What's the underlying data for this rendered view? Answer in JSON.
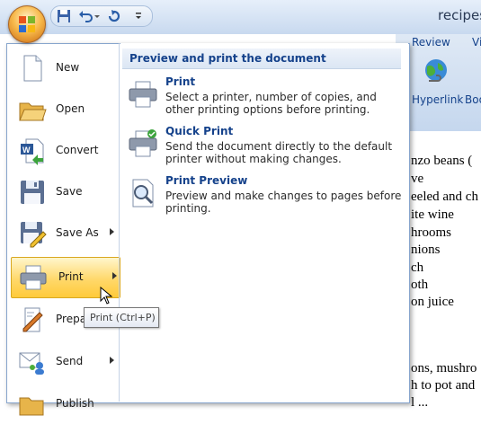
{
  "window": {
    "doc_title": "recipes"
  },
  "ribbon": {
    "tabs": [
      "Review",
      "Vi"
    ],
    "hyperlink_label": "Hyperlink",
    "book_label": "Boo"
  },
  "document": {
    "lines": [
      "nzo beans (",
      "ve",
      "eeled and ch",
      "ite wine",
      "hrooms",
      "nions",
      "ch",
      "oth",
      "on juice",
      "",
      "",
      "ons, mushro",
      "h to pot and",
      "l ... "
    ]
  },
  "office_menu": {
    "items": [
      {
        "label": "New",
        "icon": "new-document-icon",
        "has_submenu": false
      },
      {
        "label": "Open",
        "icon": "open-folder-icon",
        "has_submenu": false
      },
      {
        "label": "Convert",
        "icon": "convert-icon",
        "has_submenu": false
      },
      {
        "label": "Save",
        "icon": "save-floppy-icon",
        "has_submenu": false
      },
      {
        "label": "Save As",
        "icon": "save-as-icon",
        "has_submenu": true
      },
      {
        "label": "Print",
        "icon": "printer-icon",
        "has_submenu": true
      },
      {
        "label": "Prepare",
        "icon": "prepare-icon",
        "has_submenu": true
      },
      {
        "label": "Send",
        "icon": "send-icon",
        "has_submenu": true
      },
      {
        "label": "Publish",
        "icon": "publish-icon",
        "has_submenu": true
      }
    ],
    "submenu_title": "Preview and print the document",
    "submenu": [
      {
        "title": "Print",
        "desc": "Select a printer, number of copies, and other printing options before printing."
      },
      {
        "title": "Quick Print",
        "desc": "Send the document directly to the default printer without making changes."
      },
      {
        "title": "Print Preview",
        "desc": "Preview and make changes to pages before printing."
      }
    ]
  },
  "tooltip": {
    "text": "Print (Ctrl+P)"
  },
  "colors": {
    "accent_text": "#15428b",
    "highlight": "#ffd86a"
  }
}
